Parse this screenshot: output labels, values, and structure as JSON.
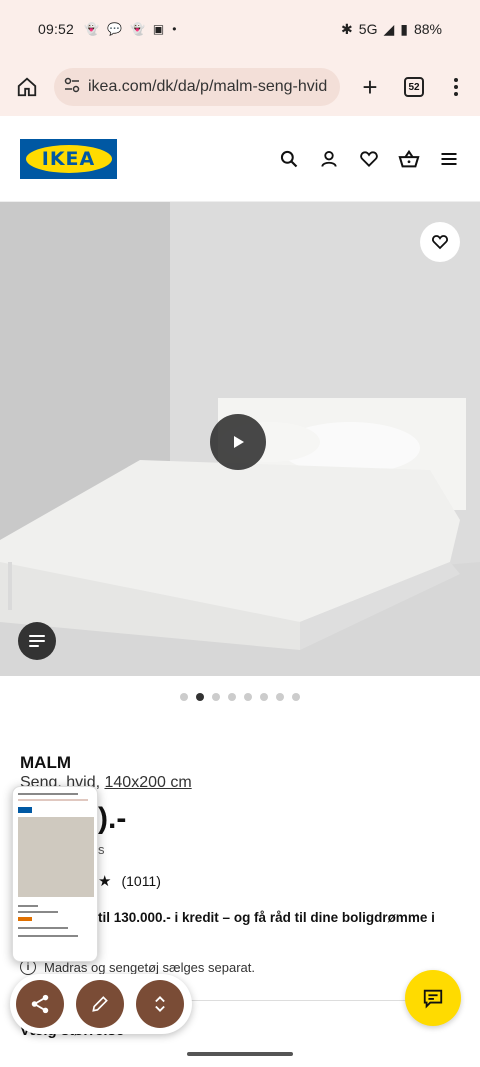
{
  "status_bar": {
    "time": "09:52",
    "network": "5G",
    "battery": "88%"
  },
  "browser": {
    "url": "ikea.com/dk/da/p/malm-seng-hvid",
    "tab_count": "52"
  },
  "site": {
    "logo_text": "IKEA",
    "brand_colors": {
      "blue": "#0058a3",
      "yellow": "#ffdb00"
    },
    "header_icons": [
      "search-icon",
      "account-icon",
      "heart-icon",
      "basket-icon",
      "menu-icon"
    ]
  },
  "product": {
    "name": "MALM",
    "desc_prefix": "Seng, hvid, ",
    "size": "140x200 cm",
    "price_visible": ").-",
    "price_note_visible": "s",
    "review_count": "(1011)",
    "credit_text": "til 130.000.- i kredit – og få råd til dine boligdrømme i",
    "notice": "Madras og sengetøj sælges separat.",
    "choose_size_visible": "Vælg størrelse"
  },
  "carousel": {
    "total": 8,
    "active_index": 1
  }
}
